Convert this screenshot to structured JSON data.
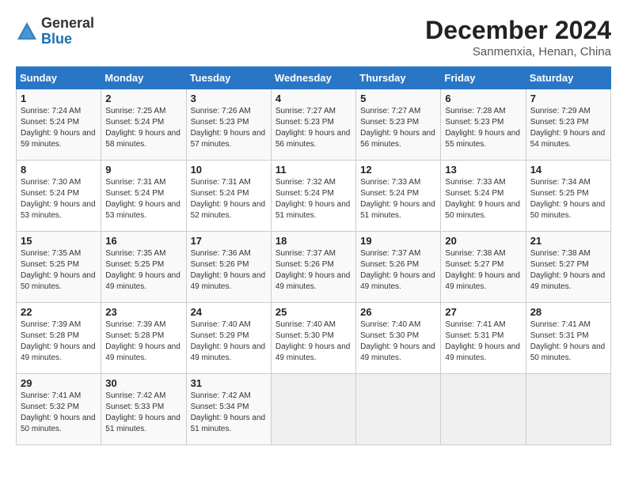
{
  "logo": {
    "general": "General",
    "blue": "Blue"
  },
  "title": "December 2024",
  "location": "Sanmenxia, Henan, China",
  "days_of_week": [
    "Sunday",
    "Monday",
    "Tuesday",
    "Wednesday",
    "Thursday",
    "Friday",
    "Saturday"
  ],
  "weeks": [
    [
      {
        "day": 1,
        "sunrise": "7:24 AM",
        "sunset": "5:24 PM",
        "daylight": "9 hours and 59 minutes."
      },
      {
        "day": 2,
        "sunrise": "7:25 AM",
        "sunset": "5:24 PM",
        "daylight": "9 hours and 58 minutes."
      },
      {
        "day": 3,
        "sunrise": "7:26 AM",
        "sunset": "5:23 PM",
        "daylight": "9 hours and 57 minutes."
      },
      {
        "day": 4,
        "sunrise": "7:27 AM",
        "sunset": "5:23 PM",
        "daylight": "9 hours and 56 minutes."
      },
      {
        "day": 5,
        "sunrise": "7:27 AM",
        "sunset": "5:23 PM",
        "daylight": "9 hours and 56 minutes."
      },
      {
        "day": 6,
        "sunrise": "7:28 AM",
        "sunset": "5:23 PM",
        "daylight": "9 hours and 55 minutes."
      },
      {
        "day": 7,
        "sunrise": "7:29 AM",
        "sunset": "5:23 PM",
        "daylight": "9 hours and 54 minutes."
      }
    ],
    [
      {
        "day": 8,
        "sunrise": "7:30 AM",
        "sunset": "5:24 PM",
        "daylight": "9 hours and 53 minutes."
      },
      {
        "day": 9,
        "sunrise": "7:31 AM",
        "sunset": "5:24 PM",
        "daylight": "9 hours and 53 minutes."
      },
      {
        "day": 10,
        "sunrise": "7:31 AM",
        "sunset": "5:24 PM",
        "daylight": "9 hours and 52 minutes."
      },
      {
        "day": 11,
        "sunrise": "7:32 AM",
        "sunset": "5:24 PM",
        "daylight": "9 hours and 51 minutes."
      },
      {
        "day": 12,
        "sunrise": "7:33 AM",
        "sunset": "5:24 PM",
        "daylight": "9 hours and 51 minutes."
      },
      {
        "day": 13,
        "sunrise": "7:33 AM",
        "sunset": "5:24 PM",
        "daylight": "9 hours and 50 minutes."
      },
      {
        "day": 14,
        "sunrise": "7:34 AM",
        "sunset": "5:25 PM",
        "daylight": "9 hours and 50 minutes."
      }
    ],
    [
      {
        "day": 15,
        "sunrise": "7:35 AM",
        "sunset": "5:25 PM",
        "daylight": "9 hours and 50 minutes."
      },
      {
        "day": 16,
        "sunrise": "7:35 AM",
        "sunset": "5:25 PM",
        "daylight": "9 hours and 49 minutes."
      },
      {
        "day": 17,
        "sunrise": "7:36 AM",
        "sunset": "5:26 PM",
        "daylight": "9 hours and 49 minutes."
      },
      {
        "day": 18,
        "sunrise": "7:37 AM",
        "sunset": "5:26 PM",
        "daylight": "9 hours and 49 minutes."
      },
      {
        "day": 19,
        "sunrise": "7:37 AM",
        "sunset": "5:26 PM",
        "daylight": "9 hours and 49 minutes."
      },
      {
        "day": 20,
        "sunrise": "7:38 AM",
        "sunset": "5:27 PM",
        "daylight": "9 hours and 49 minutes."
      },
      {
        "day": 21,
        "sunrise": "7:38 AM",
        "sunset": "5:27 PM",
        "daylight": "9 hours and 49 minutes."
      }
    ],
    [
      {
        "day": 22,
        "sunrise": "7:39 AM",
        "sunset": "5:28 PM",
        "daylight": "9 hours and 49 minutes."
      },
      {
        "day": 23,
        "sunrise": "7:39 AM",
        "sunset": "5:28 PM",
        "daylight": "9 hours and 49 minutes."
      },
      {
        "day": 24,
        "sunrise": "7:40 AM",
        "sunset": "5:29 PM",
        "daylight": "9 hours and 49 minutes."
      },
      {
        "day": 25,
        "sunrise": "7:40 AM",
        "sunset": "5:30 PM",
        "daylight": "9 hours and 49 minutes."
      },
      {
        "day": 26,
        "sunrise": "7:40 AM",
        "sunset": "5:30 PM",
        "daylight": "9 hours and 49 minutes."
      },
      {
        "day": 27,
        "sunrise": "7:41 AM",
        "sunset": "5:31 PM",
        "daylight": "9 hours and 49 minutes."
      },
      {
        "day": 28,
        "sunrise": "7:41 AM",
        "sunset": "5:31 PM",
        "daylight": "9 hours and 50 minutes."
      }
    ],
    [
      {
        "day": 29,
        "sunrise": "7:41 AM",
        "sunset": "5:32 PM",
        "daylight": "9 hours and 50 minutes."
      },
      {
        "day": 30,
        "sunrise": "7:42 AM",
        "sunset": "5:33 PM",
        "daylight": "9 hours and 51 minutes."
      },
      {
        "day": 31,
        "sunrise": "7:42 AM",
        "sunset": "5:34 PM",
        "daylight": "9 hours and 51 minutes."
      },
      null,
      null,
      null,
      null
    ]
  ]
}
